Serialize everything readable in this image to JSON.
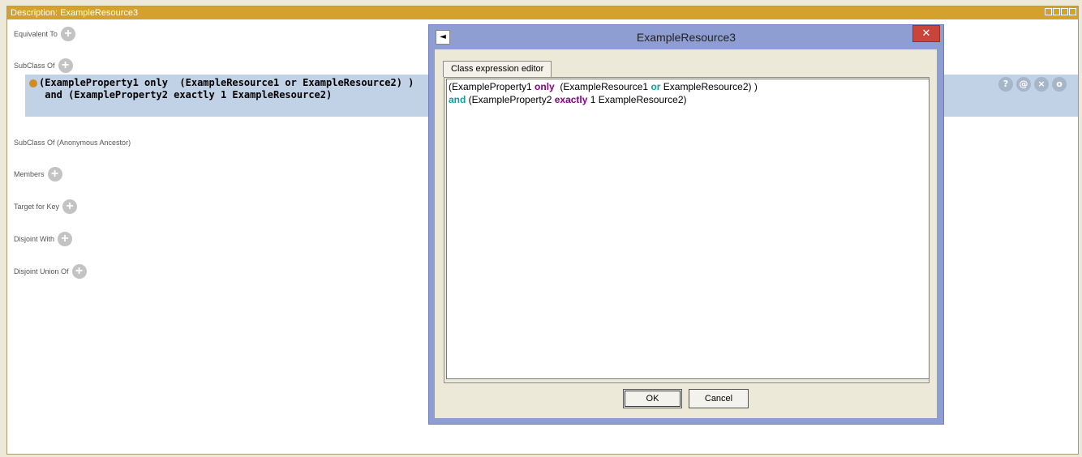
{
  "panel": {
    "title": "Description: ExampleResource3"
  },
  "sections": {
    "equivalent_to": "Equivalent To",
    "subclass_of": "SubClass Of",
    "subclass_anon": "SubClass Of (Anonymous Ancestor)",
    "members": "Members",
    "target_for_key": "Target for Key",
    "disjoint_with": "Disjoint With",
    "disjoint_union_of": "Disjoint Union Of",
    "add_symbol": "+"
  },
  "subclass_expression": {
    "line1": "(ExampleProperty1 only  (ExampleResource1 or ExampleResource2) )",
    "line2": " and (ExampleProperty2 exactly 1 ExampleResource2)",
    "row_icons": [
      "?",
      "@",
      "×",
      "o"
    ]
  },
  "dialog": {
    "title": "ExampleResource3",
    "close_symbol": "✕",
    "tab_label": "Class expression editor",
    "expr": {
      "t1": "(ExampleProperty1 ",
      "k1": "only",
      "t2": "  (ExampleResource1 ",
      "k2": "or",
      "t3": " ExampleResource2) )",
      "k3": "and",
      "t4": " (ExampleProperty2 ",
      "k4": "exactly",
      "t5": " 1 ExampleResource2)"
    },
    "ok_label": "OK",
    "cancel_label": "Cancel"
  },
  "colors": {
    "title_bar": "#d4a12c",
    "selection": "#c1d1e6",
    "dialog_frame": "#8e9ed3",
    "keyword_purple": "#8a008a",
    "keyword_teal": "#0f9ea0"
  }
}
